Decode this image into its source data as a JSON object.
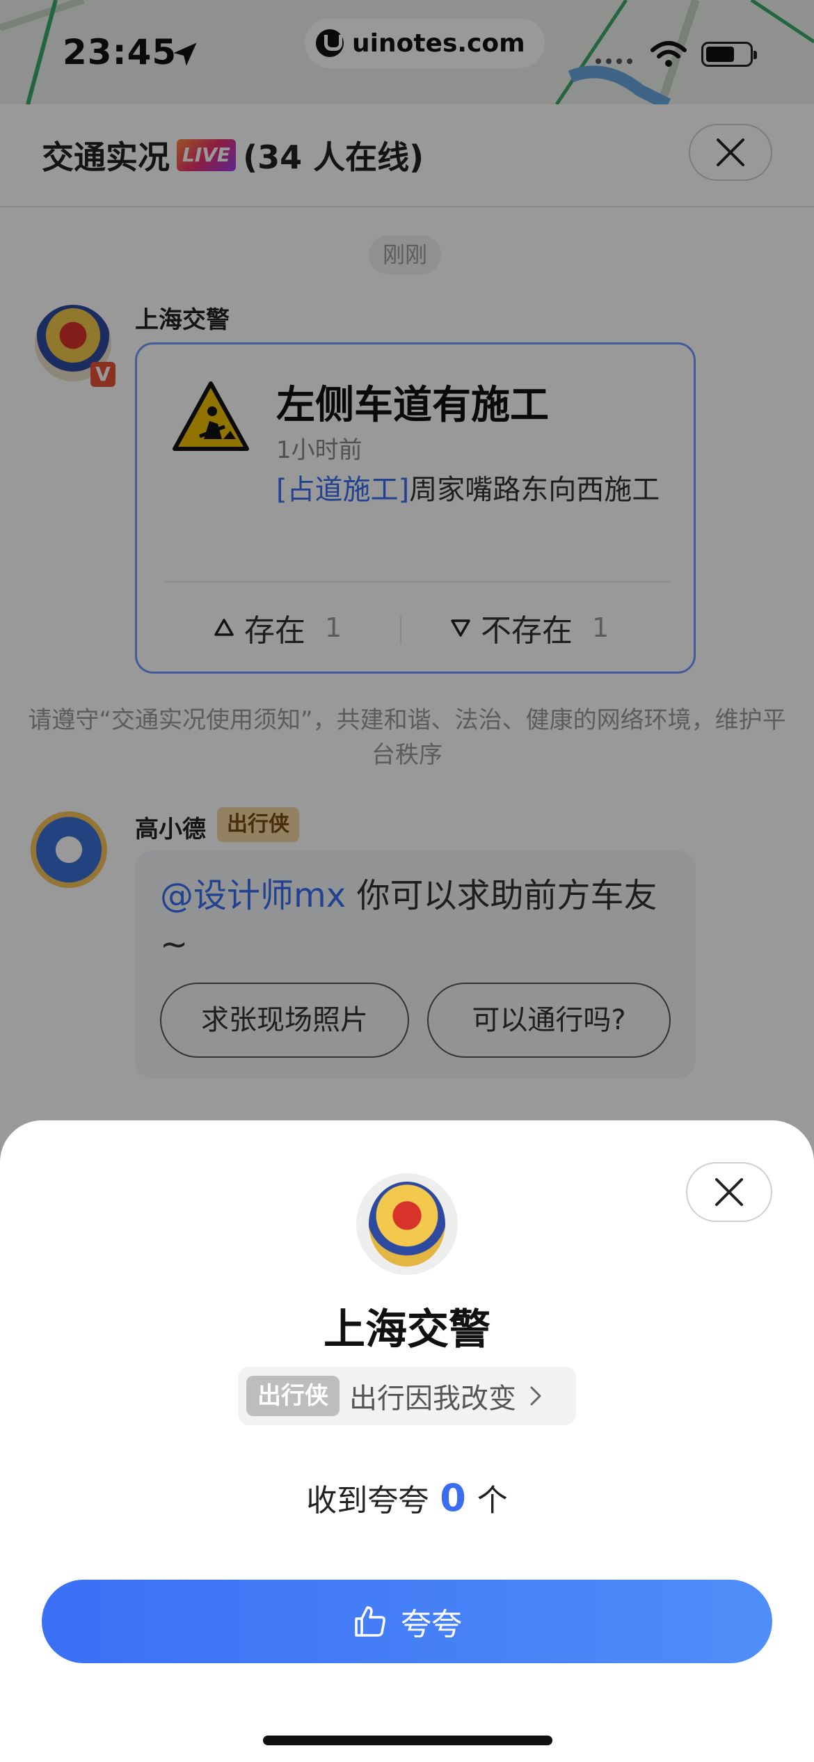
{
  "status_bar": {
    "time": "23:45",
    "watermark": "uinotes.com"
  },
  "header": {
    "title": "交通实况",
    "live_badge": "LIVE",
    "online_count": "(34 人在线)"
  },
  "chat": {
    "time_chip": "刚刚",
    "police_message": {
      "sender": "上海交警",
      "verified_badge": "V",
      "card": {
        "icon": "road-work-warning-icon",
        "title": "左侧车道有施工",
        "time_ago": "1小时前",
        "tag": "[占道施工]",
        "description": "周家嘴路东向西施工",
        "vote_exists_label": "存在",
        "vote_exists_count": "1",
        "vote_not_exists_label": "不存在",
        "vote_not_exists_count": "1"
      }
    },
    "notice": "请遵守“交通实况使用须知”，共建和谐、法治、健康的网络环境，维护平台秩序",
    "bot_message": {
      "sender": "高小德",
      "badge": "出行侠",
      "mention": "@设计师mx",
      "text": "你可以求助前方车友~",
      "quick_replies": [
        "求张现场照片",
        "可以通行吗?"
      ]
    }
  },
  "sheet": {
    "name": "上海交警",
    "badge": "出行侠",
    "slogan": "出行因我改变",
    "praise_prefix": "收到夸夸",
    "praise_count": "0",
    "praise_suffix": "个",
    "praise_button_label": "夸夸"
  },
  "colors": {
    "accent_blue": "#3a6df0",
    "button_gradient_start": "#3b6ff5",
    "button_gradient_end": "#4f8ef8",
    "card_border": "#6e99ff",
    "badge_gold": "#f5d9a4"
  }
}
